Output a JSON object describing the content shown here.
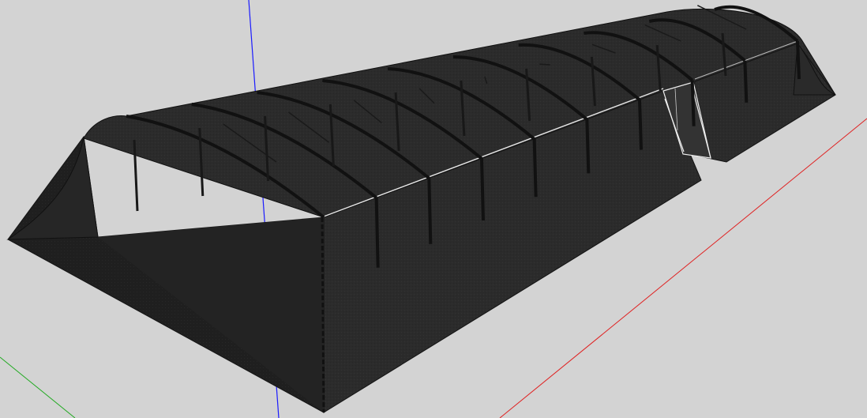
{
  "viewport": {
    "background_color": "#d3d3d3"
  },
  "axes": {
    "blue_axis_color": "#1a1aff",
    "red_axis_color": "#e02020",
    "green_axis_color": "#22aa22"
  },
  "model": {
    "name": "shade-net-structure",
    "fabric_color": "#2a2a2a",
    "fabric_dark_color": "#1e1e1e",
    "frame_color": "#111111",
    "highlight_color": "#e8e8e8",
    "arch_count": 10,
    "has_door_opening": true
  }
}
